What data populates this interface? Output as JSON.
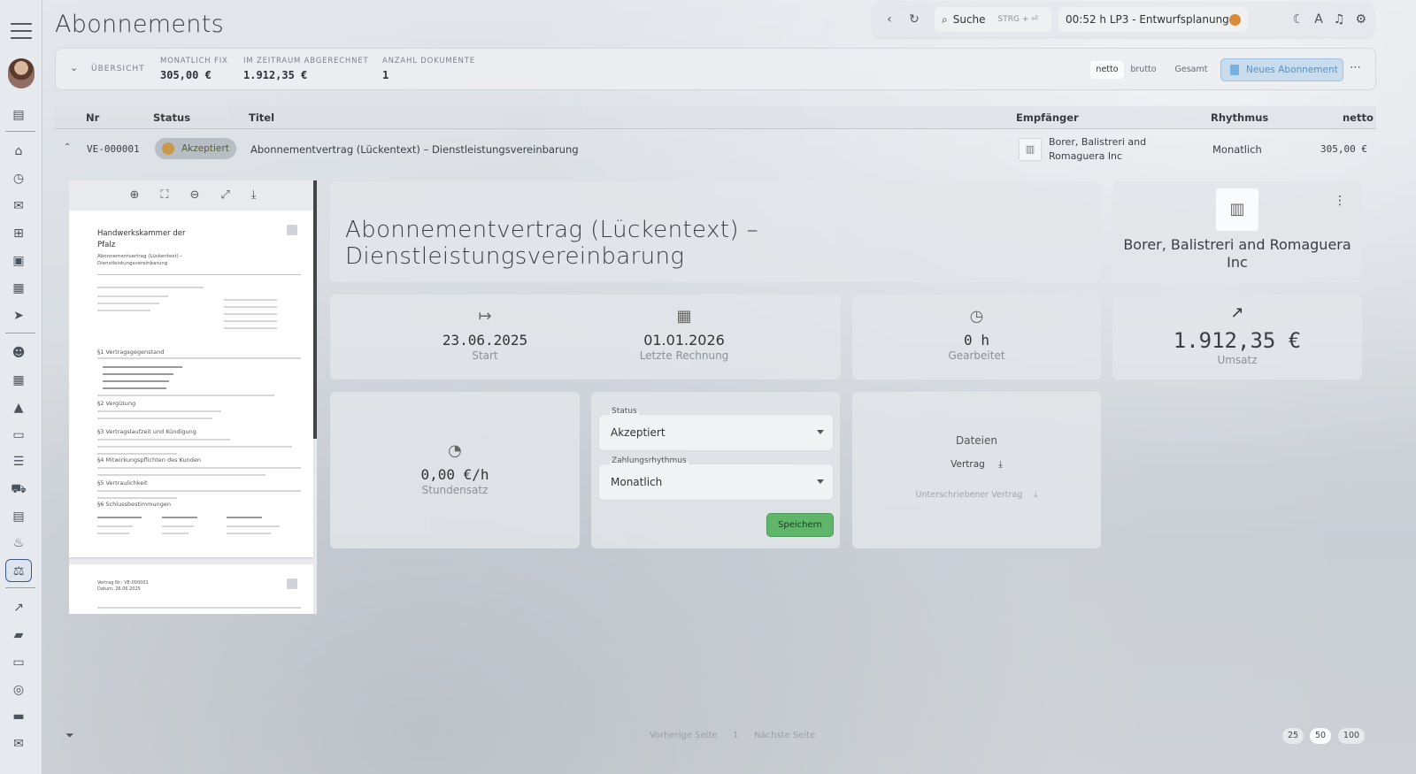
{
  "page_title": "Abonnements",
  "topbar": {
    "search_label": "Suche",
    "search_shortcut": "STRG + ⏎",
    "timer_text": "00:52 h  LP3 - Entwurfsplanung"
  },
  "overview": {
    "label": "ÜBERSICHT",
    "columns": [
      {
        "key": "MONATLICH FIX",
        "value": "305,00 €"
      },
      {
        "key": "IM ZEITRAUM ABGERECHNET",
        "value": "1.912,35 €"
      },
      {
        "key": "ANZAHL DOKUMENTE",
        "value": "1"
      }
    ],
    "toggle": {
      "netto": "netto",
      "brutto": "brutto",
      "gesamt": "Gesamt"
    },
    "new_button": "Neues Abonnement"
  },
  "table": {
    "headers": {
      "nr": "Nr",
      "status": "Status",
      "titel": "Titel",
      "empfaenger": "Empfänger",
      "rhythmus": "Rhythmus",
      "netto": "netto"
    },
    "row": {
      "nr": "VE-000001",
      "status": "Akzeptiert",
      "titel": "Abonnementvertrag (Lückentext) – Dienstleistungsvereinbarung",
      "empfaenger": "Borer, Balistreri and Romaguera Inc",
      "rhythmus": "Monatlich",
      "netto": "305,00 €"
    }
  },
  "preview": {
    "org": "Handwerkskammer der Pfalz",
    "doc_title": "Abonnementvertrag (Lückentext) – Dienstleistungsvereinbarung",
    "sections": [
      "§1 Vertragsgegenstand",
      "§2 Vergütung",
      "§3 Vertragslaufzeit und Kündigung",
      "§4 Mitwirkungspflichten des Kunden",
      "§5 Vertraulichkeit",
      "§6 Schlussbestimmungen"
    ],
    "page2_lines": [
      "Vertrag Nr.: VE-000001",
      "Datum: 26.06.2025"
    ]
  },
  "detail": {
    "title": "Abonnementvertrag (Lückentext) – Dienstleistungsvereinbarung",
    "customer": "Borer, Balistreri and Romaguera Inc",
    "start_value": "23.06.2025",
    "start_label": "Start",
    "last_invoice_value": "01.01.2026",
    "last_invoice_label": "Letzte Rechnung",
    "worked_value": "0 h",
    "worked_label": "Gearbeitet",
    "umsatz_value": "1.912,35 €",
    "umsatz_label": "Umsatz",
    "rate_value": "0,00 €/h",
    "rate_label": "Stundensatz",
    "status_label": "Status",
    "status_value": "Akzeptiert",
    "rhythm_label": "Zahlungsrhythmus",
    "rhythm_value": "Monatlich",
    "save_button": "Speichern",
    "files_title": "Dateien",
    "file_contract": "Vertrag",
    "file_signed": "Unterschriebener Vertrag"
  },
  "footer": {
    "prev": "Vorherige Seite",
    "page": "1",
    "next": "Nächste Seite",
    "sizes": [
      "25",
      "50",
      "100"
    ]
  }
}
